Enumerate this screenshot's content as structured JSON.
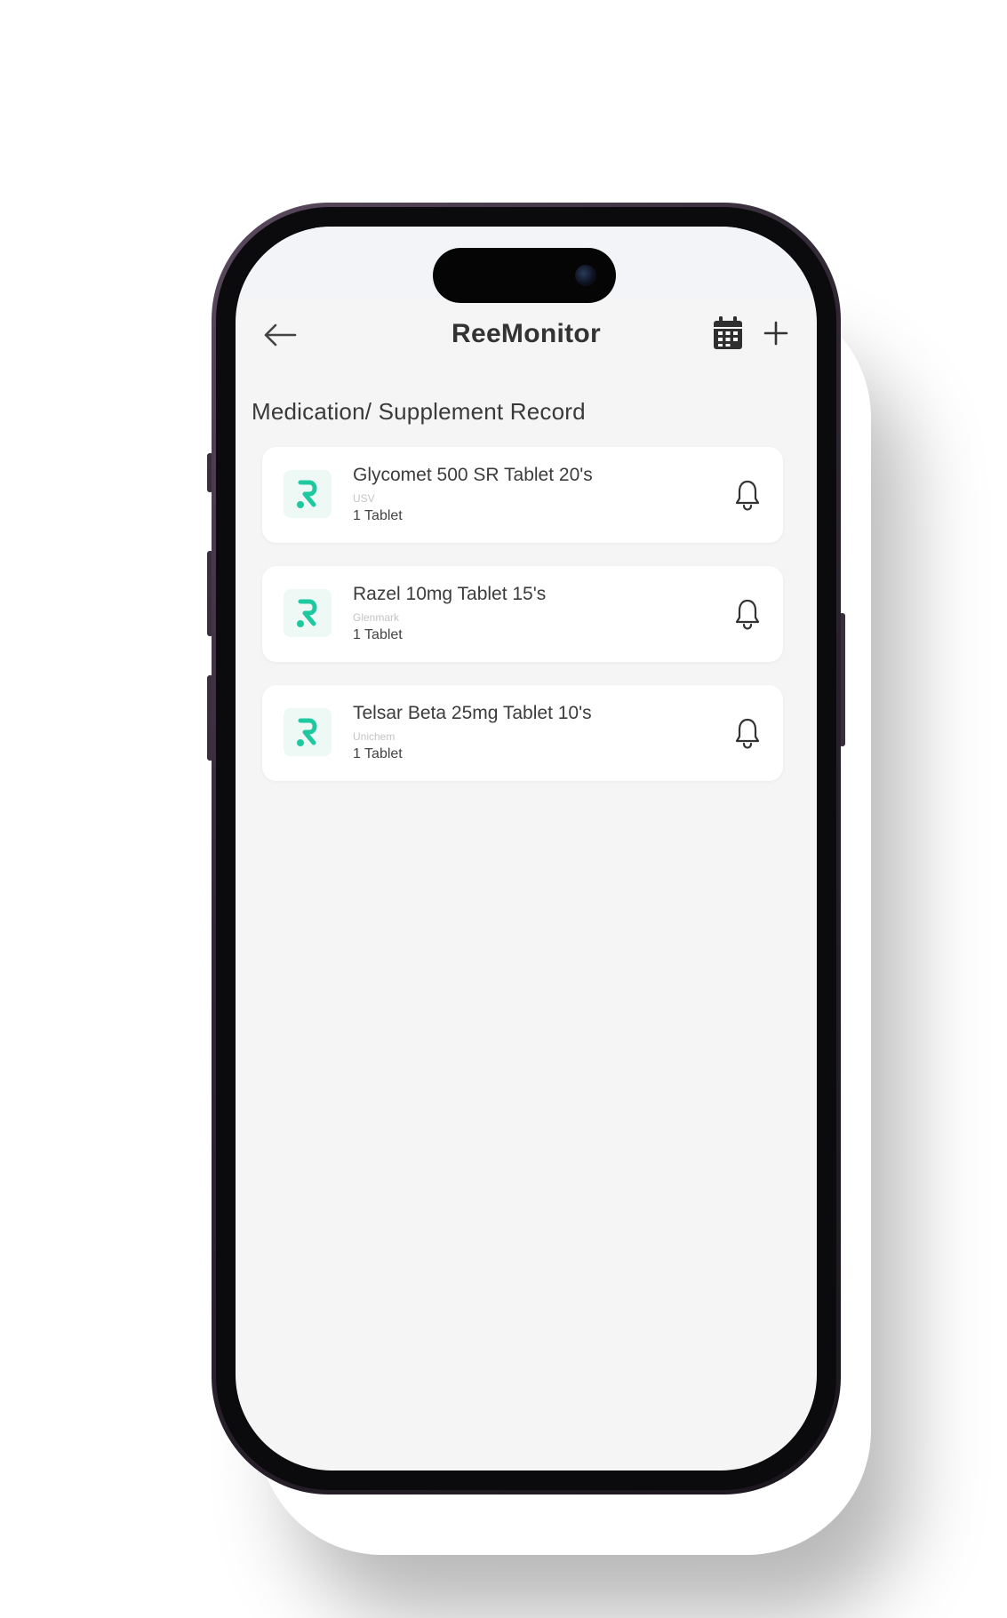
{
  "app": {
    "title": "ReeMonitor"
  },
  "header": {
    "back_icon": "arrow-left-icon",
    "calendar_icon": "calendar-icon",
    "add_icon": "plus-icon"
  },
  "section": {
    "title": "Medication/ Supplement Record"
  },
  "medications": [
    {
      "name": "Glycomet 500 SR Tablet 20's",
      "brand": "USV",
      "dose": "1 Tablet",
      "icon": "bell-icon"
    },
    {
      "name": "Razel 10mg Tablet 15's",
      "brand": "Glenmark",
      "dose": "1 Tablet",
      "icon": "bell-icon"
    },
    {
      "name": "Telsar Beta 25mg Tablet 10's",
      "brand": "Unichem",
      "dose": "1 Tablet",
      "icon": "bell-icon"
    }
  ],
  "colors": {
    "accent": "#1fc9a0",
    "screen_bg": "#f5f5f5",
    "card_bg": "#ffffff",
    "phone_frame": "#2e2531"
  }
}
